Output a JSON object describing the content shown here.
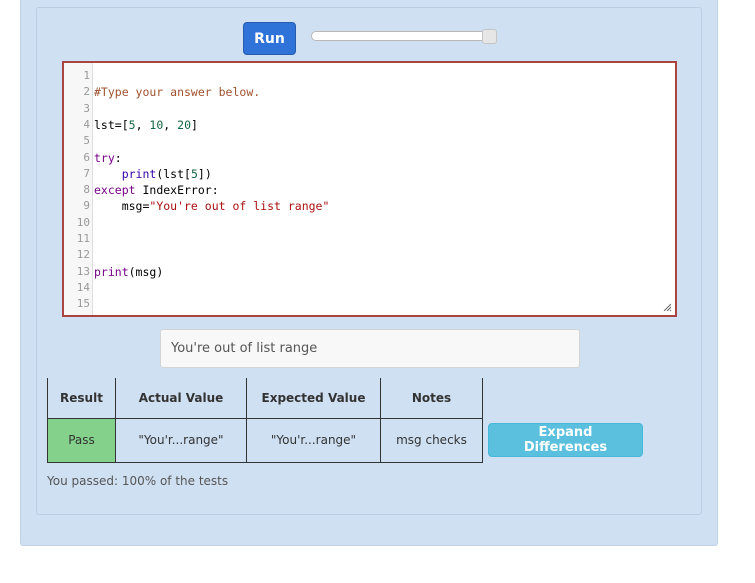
{
  "toolbar": {
    "run_label": "Run"
  },
  "slider": {
    "value_fraction": 1.0
  },
  "editor": {
    "lines": [
      {
        "n": "1",
        "tokens": []
      },
      {
        "n": "2",
        "tokens": [
          {
            "t": "#Type your answer below.",
            "c": "comment"
          }
        ]
      },
      {
        "n": "3",
        "tokens": []
      },
      {
        "n": "4",
        "tokens": [
          {
            "t": "lst=[",
            "c": ""
          },
          {
            "t": "5",
            "c": "num"
          },
          {
            "t": ", ",
            "c": ""
          },
          {
            "t": "10",
            "c": "num"
          },
          {
            "t": ", ",
            "c": ""
          },
          {
            "t": "20",
            "c": "num"
          },
          {
            "t": "]",
            "c": ""
          }
        ]
      },
      {
        "n": "5",
        "tokens": []
      },
      {
        "n": "6",
        "tokens": [
          {
            "t": "try",
            "c": "kw"
          },
          {
            "t": ":",
            "c": ""
          }
        ]
      },
      {
        "n": "7",
        "tokens": [
          {
            "t": "    ",
            "c": ""
          },
          {
            "t": "print",
            "c": "bi"
          },
          {
            "t": "(lst[",
            "c": ""
          },
          {
            "t": "5",
            "c": "num"
          },
          {
            "t": "])",
            "c": ""
          }
        ]
      },
      {
        "n": "8",
        "tokens": [
          {
            "t": "except",
            "c": "kw"
          },
          {
            "t": " IndexError:",
            "c": ""
          }
        ]
      },
      {
        "n": "9",
        "tokens": [
          {
            "t": "    msg=",
            "c": ""
          },
          {
            "t": "\"You're out of list range\"",
            "c": "str"
          }
        ]
      },
      {
        "n": "10",
        "tokens": []
      },
      {
        "n": "11",
        "tokens": []
      },
      {
        "n": "12",
        "tokens": []
      },
      {
        "n": "13",
        "tokens": [
          {
            "t": "print",
            "c": "kw"
          },
          {
            "t": "(msg)",
            "c": ""
          }
        ]
      },
      {
        "n": "14",
        "tokens": []
      },
      {
        "n": "15",
        "tokens": []
      }
    ]
  },
  "output": {
    "text": "You're out of list range"
  },
  "results": {
    "headers": [
      "Result",
      "Actual Value",
      "Expected Value",
      "Notes"
    ],
    "rows": [
      {
        "result": "Pass",
        "actual": "\"You'r...range\"",
        "expected": "\"You'r...range\"",
        "notes": "msg checks"
      }
    ]
  },
  "expand_label": "Expand Differences",
  "summary": "You passed: 100% of the tests",
  "colors": {
    "run": "#2f72d8",
    "pass": "#83d18b",
    "expand": "#5bc0de",
    "error_border": "#a94442",
    "panel": "#cfe0f3"
  }
}
